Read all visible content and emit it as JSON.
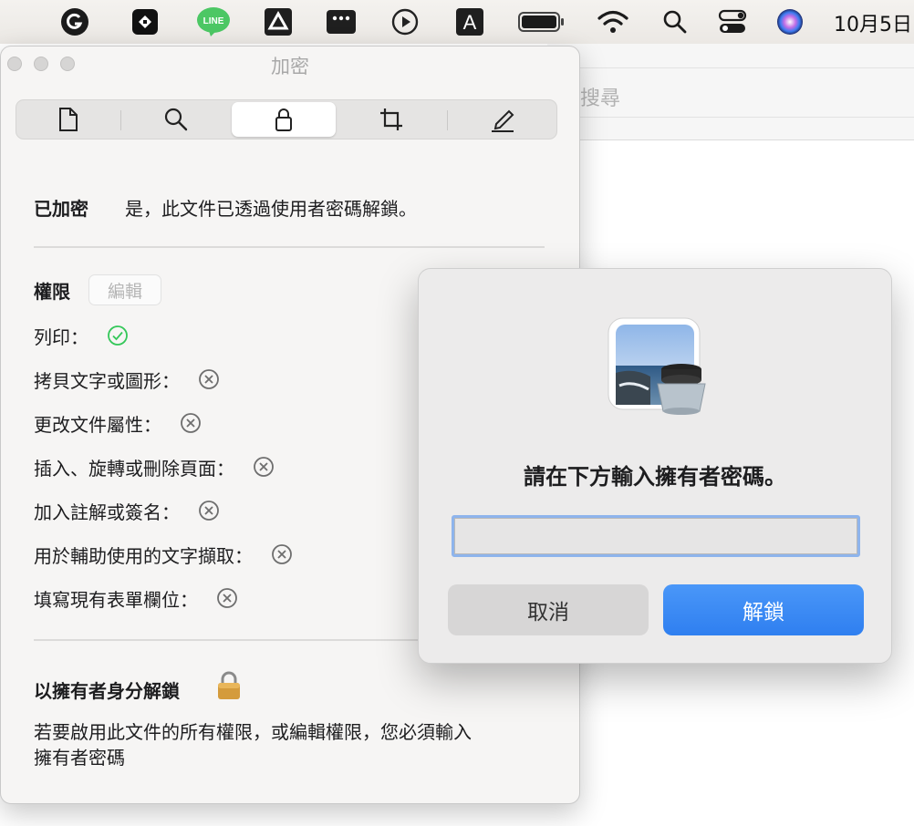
{
  "menubar": {
    "icons": [
      "grammarly-icon",
      "app-icon",
      "line-icon",
      "drive-icon",
      "dots-app-icon",
      "play-icon",
      "a-app-icon",
      "battery-icon",
      "wifi-icon",
      "search-icon",
      "control-center-icon",
      "siri-icon"
    ],
    "line_label": "LINE",
    "a_label": "A",
    "clock": "10月5日"
  },
  "background_window": {
    "search_placeholder": "搜尋"
  },
  "panel": {
    "title": "加密",
    "tabs": [
      {
        "name": "document-icon",
        "active": false
      },
      {
        "name": "search-icon",
        "active": false
      },
      {
        "name": "lock-icon",
        "active": true
      },
      {
        "name": "crop-icon",
        "active": false
      },
      {
        "name": "annotate-icon",
        "active": false
      }
    ],
    "encrypted_label": "已加密",
    "encrypted_value": "是，此文件已透過使用者密碼解鎖。",
    "permissions_label": "權限",
    "edit_label": "編輯",
    "permissions": [
      {
        "label": "列印：",
        "allowed": true
      },
      {
        "label": "拷貝文字或圖形：",
        "allowed": false
      },
      {
        "label": "更改文件屬性：",
        "allowed": false
      },
      {
        "label": "插入、旋轉或刪除頁面：",
        "allowed": false
      },
      {
        "label": "加入註解或簽名：",
        "allowed": false
      },
      {
        "label": "用於輔助使用的文字擷取：",
        "allowed": false
      },
      {
        "label": "填寫現有表單欄位：",
        "allowed": false
      }
    ],
    "owner_unlock_title": "以擁有者身分解鎖",
    "owner_unlock_desc_1": "若要啟用此文件的所有權限，或編輯權限，您必須輸入",
    "owner_unlock_desc_2": "擁有者密碼"
  },
  "dialog": {
    "message": "請在下方輸入擁有者密碼。",
    "password_value": "",
    "cancel_label": "取消",
    "unlock_label": "解鎖"
  },
  "colors": {
    "accent": "#3a88f5",
    "allowed": "#34c759",
    "denied": "#6e6e6e"
  }
}
